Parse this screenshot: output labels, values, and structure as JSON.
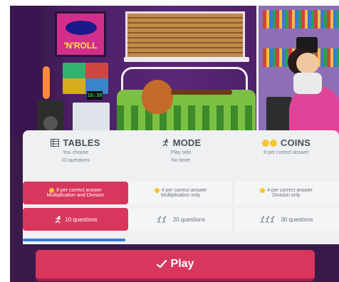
{
  "scene": {
    "poster_text": "'N'ROLL",
    "clock_text": "16:30"
  },
  "columns": [
    {
      "title": "TABLES",
      "icon": "table-icon",
      "sub1": "You choose",
      "sub2": "10 questions"
    },
    {
      "title": "MODE",
      "icon": "runner-icon",
      "sub1": "Play solo",
      "sub2": "No timer"
    },
    {
      "title": "COINS",
      "icon": "coins-icon",
      "sub1": "8 per correct answer",
      "sub2": ""
    }
  ],
  "coin_options": [
    {
      "line1": "8 per correct answer",
      "line2": "Multiplication and Division",
      "selected": true
    },
    {
      "line1": "4 per correct answer",
      "line2": "Multiplication only",
      "selected": false
    },
    {
      "line1": "4 per correct answer",
      "line2": "Division only",
      "selected": false
    }
  ],
  "question_options": [
    {
      "label": "10 questions",
      "icon": "runner-icon",
      "selected": true
    },
    {
      "label": "20 questions",
      "icon": "runners-icon",
      "selected": false
    },
    {
      "label": "30 questions",
      "icon": "runners-icon",
      "selected": false
    }
  ],
  "play_button": {
    "label": "Play",
    "icon": "checkmark-icon"
  },
  "colors": {
    "accent": "#d9365e",
    "coin": "#f4c531",
    "tab_underline": "#3b7bd6"
  }
}
